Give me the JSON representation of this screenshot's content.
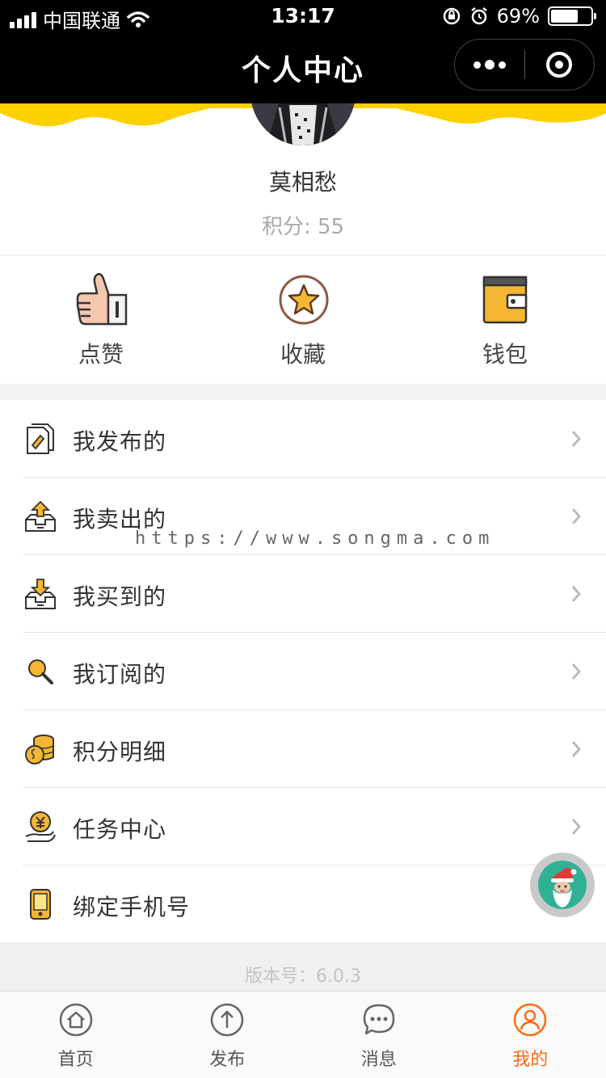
{
  "status_bar": {
    "carrier": "中国联通",
    "time": "13:17",
    "battery": "69%",
    "battery_level": 0.69
  },
  "nav": {
    "title": "个人中心"
  },
  "profile": {
    "username": "莫相愁",
    "points": "积分: 55"
  },
  "actions": [
    {
      "label": "点赞",
      "icon": "thumbs-up-icon"
    },
    {
      "label": "收藏",
      "icon": "star-icon"
    },
    {
      "label": "钱包",
      "icon": "wallet-icon"
    }
  ],
  "menu": [
    {
      "label": "我发布的",
      "icon": "publish-doc-icon"
    },
    {
      "label": "我卖出的",
      "icon": "tray-upload-icon"
    },
    {
      "label": "我买到的",
      "icon": "tray-download-icon"
    },
    {
      "label": "我订阅的",
      "icon": "magnifier-icon"
    },
    {
      "label": "积分明细",
      "icon": "coins-icon"
    },
    {
      "label": "任务中心",
      "icon": "yen-hand-icon"
    },
    {
      "label": "绑定手机号",
      "icon": "phone-icon"
    }
  ],
  "watermark": "https://www.songma.com",
  "version": "版本号：6.0.3",
  "tabs": [
    {
      "label": "首页",
      "icon": "home-icon",
      "active": false
    },
    {
      "label": "发布",
      "icon": "upload-arrow-icon",
      "active": false
    },
    {
      "label": "消息",
      "icon": "chat-bubble-icon",
      "active": false
    },
    {
      "label": "我的",
      "icon": "user-icon",
      "active": true
    }
  ],
  "colors": {
    "accent": "#ff6a13",
    "wave_yellow": "#fdd000",
    "icon_yellow": "#f5b731",
    "float_green": "#2fb294"
  }
}
